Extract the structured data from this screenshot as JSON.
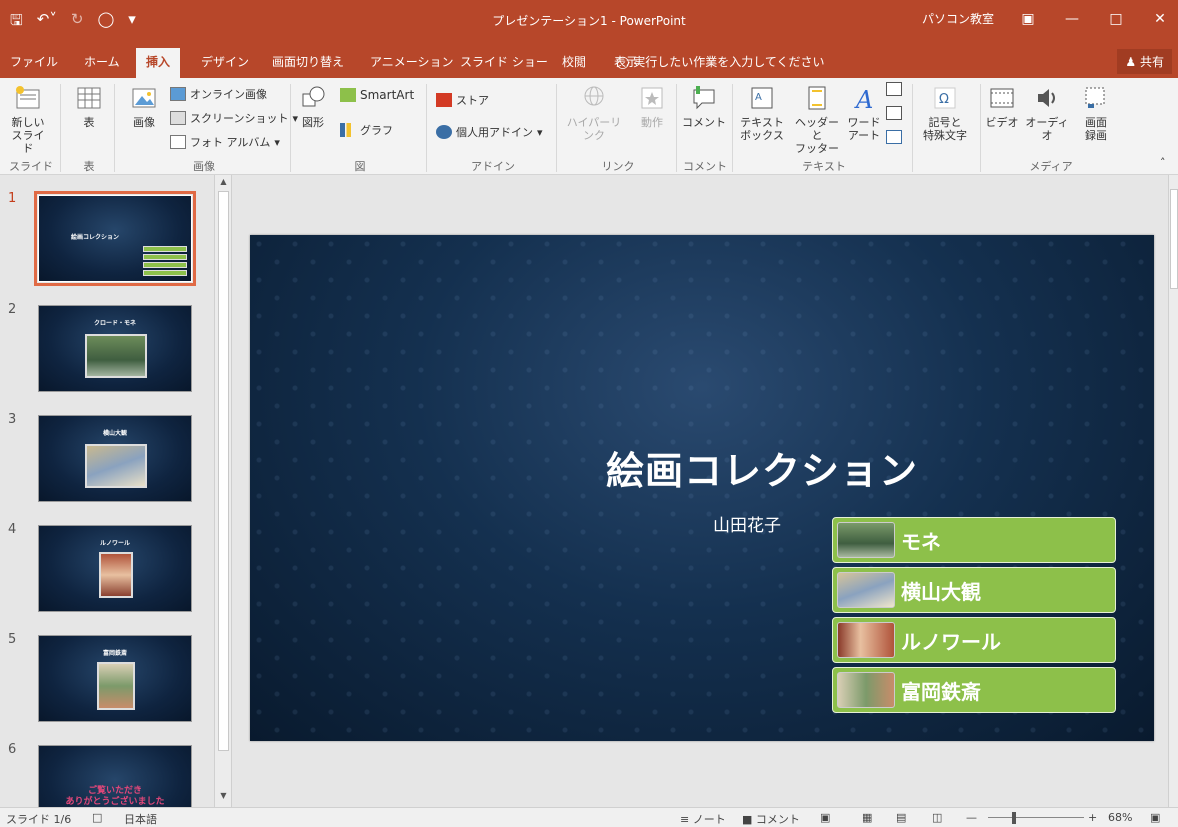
{
  "app": {
    "title": "プレゼンテーション1 - PowerPoint",
    "user": "パソコン教室"
  },
  "tabs": [
    "ファイル",
    "ホーム",
    "挿入",
    "デザイン",
    "画面切り替え",
    "アニメーション",
    "スライド ショー",
    "校閲",
    "表示"
  ],
  "active_tab": "挿入",
  "tell_me": "実行したい作業を入力してください",
  "share": "共有",
  "ribbon": {
    "new_slide": "新しい\nスライド",
    "table": "表",
    "image": "画像",
    "online_image": "オンライン画像",
    "screenshot": "スクリーンショット",
    "photo_album": "フォト アルバム",
    "shapes": "図形",
    "smartart": "SmartArt",
    "graph": "グラフ",
    "store": "ストア",
    "my_addins": "個人用アドイン",
    "hyperlink": "ハイパーリンク",
    "action": "動作",
    "comment": "コメント",
    "textbox": "テキスト\nボックス",
    "header_footer": "ヘッダーと\nフッター",
    "wordart": "ワード\nアート",
    "symbols": "記号と\n特殊文字",
    "video": "ビデオ",
    "audio": "オーディオ",
    "screen_record": "画面\n録画",
    "groups": {
      "slide": "スライド",
      "table": "表",
      "image": "画像",
      "figure": "図",
      "addin": "アドイン",
      "link": "リンク",
      "comment": "コメント",
      "text": "テキスト",
      "media": "メディア"
    }
  },
  "thumbnails": [
    {
      "num": "1",
      "title": "絵画コレクション"
    },
    {
      "num": "2",
      "title": "クロード・モネ"
    },
    {
      "num": "3",
      "title": "横山大観"
    },
    {
      "num": "4",
      "title": "ルノワール"
    },
    {
      "num": "5",
      "title": "富岡鉄斎"
    },
    {
      "num": "6",
      "title": "ご覧いただき\nありがとうございました"
    }
  ],
  "slide": {
    "title": "絵画コレクション",
    "subtitle": "山田花子",
    "items": [
      "モネ",
      "横山大観",
      "ルノワール",
      "富岡鉄斎"
    ]
  },
  "status": {
    "slide_indicator": "スライド 1/6",
    "language": "日本語",
    "notes": "ノート",
    "comments": "コメント",
    "zoom": "68%"
  },
  "colors": {
    "accent": "#b7472a",
    "smartart_green": "#8dc04a"
  }
}
